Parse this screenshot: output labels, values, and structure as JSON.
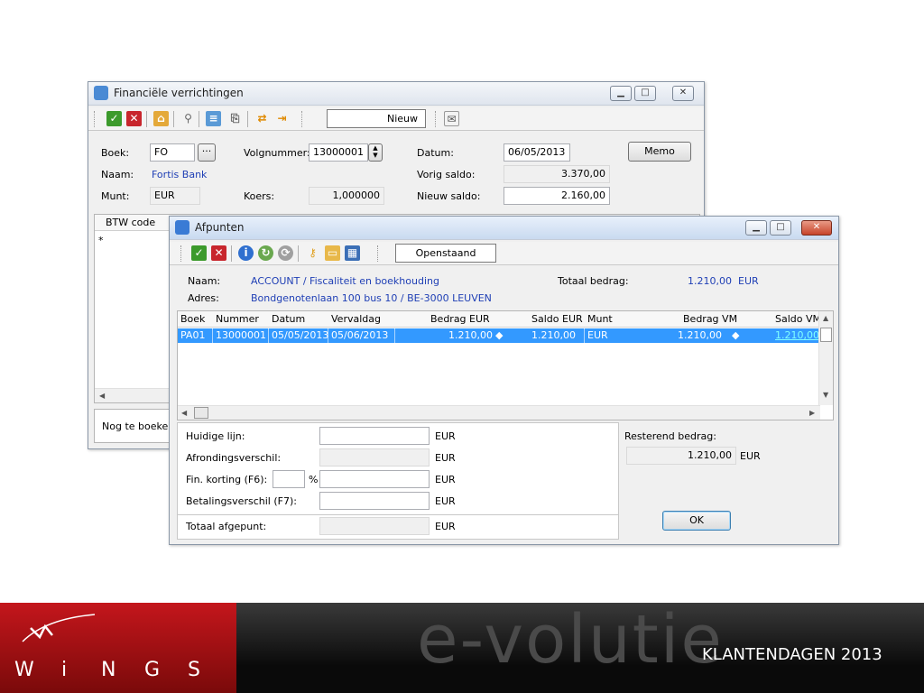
{
  "main_window": {
    "title": "Financiële verrichtingen",
    "toolbar": {
      "mode": "Nieuw"
    },
    "labels": {
      "boek": "Boek:",
      "naam": "Naam:",
      "munt": "Munt:",
      "volgnummer": "Volgnummer:",
      "koers": "Koers:",
      "datum": "Datum:",
      "vorig_saldo": "Vorig saldo:",
      "nieuw_saldo": "Nieuw saldo:"
    },
    "values": {
      "boek": "FO",
      "naam": "Fortis Bank",
      "munt": "EUR",
      "volgnummer": "13000001",
      "koers": "1,000000",
      "datum": "06/05/2013",
      "vorig_saldo": "3.370,00",
      "nieuw_saldo": "2.160,00"
    },
    "memo_button": "Memo",
    "grid_header": "BTW code",
    "new_row_marker": "*",
    "status_label": "Nog te boeken"
  },
  "dialog": {
    "title": "Afpunten",
    "toolbar": {
      "filter": "Openstaand"
    },
    "naam_label": "Naam:",
    "naam_value": "ACCOUNT / Fiscaliteit en boekhouding",
    "adres_label": "Adres:",
    "adres_value": "Bondgenotenlaan 100 bus 10 / BE-3000 LEUVEN",
    "totaal_label": "Totaal bedrag:",
    "totaal_value": "1.210,00",
    "totaal_currency": "EUR",
    "columns": [
      "Boek",
      "Nummer",
      "Datum",
      "Vervaldag",
      "Bedrag EUR",
      "Saldo EUR",
      "Munt",
      "Bedrag VM",
      "Saldo VM"
    ],
    "rows": [
      {
        "boek": "PA01",
        "nummer": "13000001",
        "datum": "05/05/2013",
        "vervaldag": "05/06/2013",
        "bedrag_eur": "1.210,00",
        "saldo_eur": "1.210,00",
        "munt": "EUR",
        "bedrag_vm": "1.210,00",
        "saldo_vm": "1.210,00"
      }
    ],
    "bottom": {
      "huidige_lijn": "Huidige lijn:",
      "afrondingsverschil": "Afrondingsverschil:",
      "fin_korting": "Fin. korting (F6):",
      "percent": "%",
      "betalingsverschil": "Betalingsverschil (F7):",
      "totaal_afgepunt": "Totaal afgepunt:",
      "currency": "EUR",
      "resterend_label": "Resterend bedrag:",
      "resterend_value": "1.210,00",
      "resterend_currency": "EUR",
      "ok": "OK"
    }
  },
  "footer": {
    "logo_letters": [
      "W",
      "i",
      "N",
      "G",
      "S"
    ],
    "slogan": "e-volutie",
    "event": "KLANTENDAGEN 2013"
  },
  "colors": {
    "selection": "#3399ff",
    "link_blue": "#1f3fb5",
    "brand_red": "#c4161c"
  }
}
